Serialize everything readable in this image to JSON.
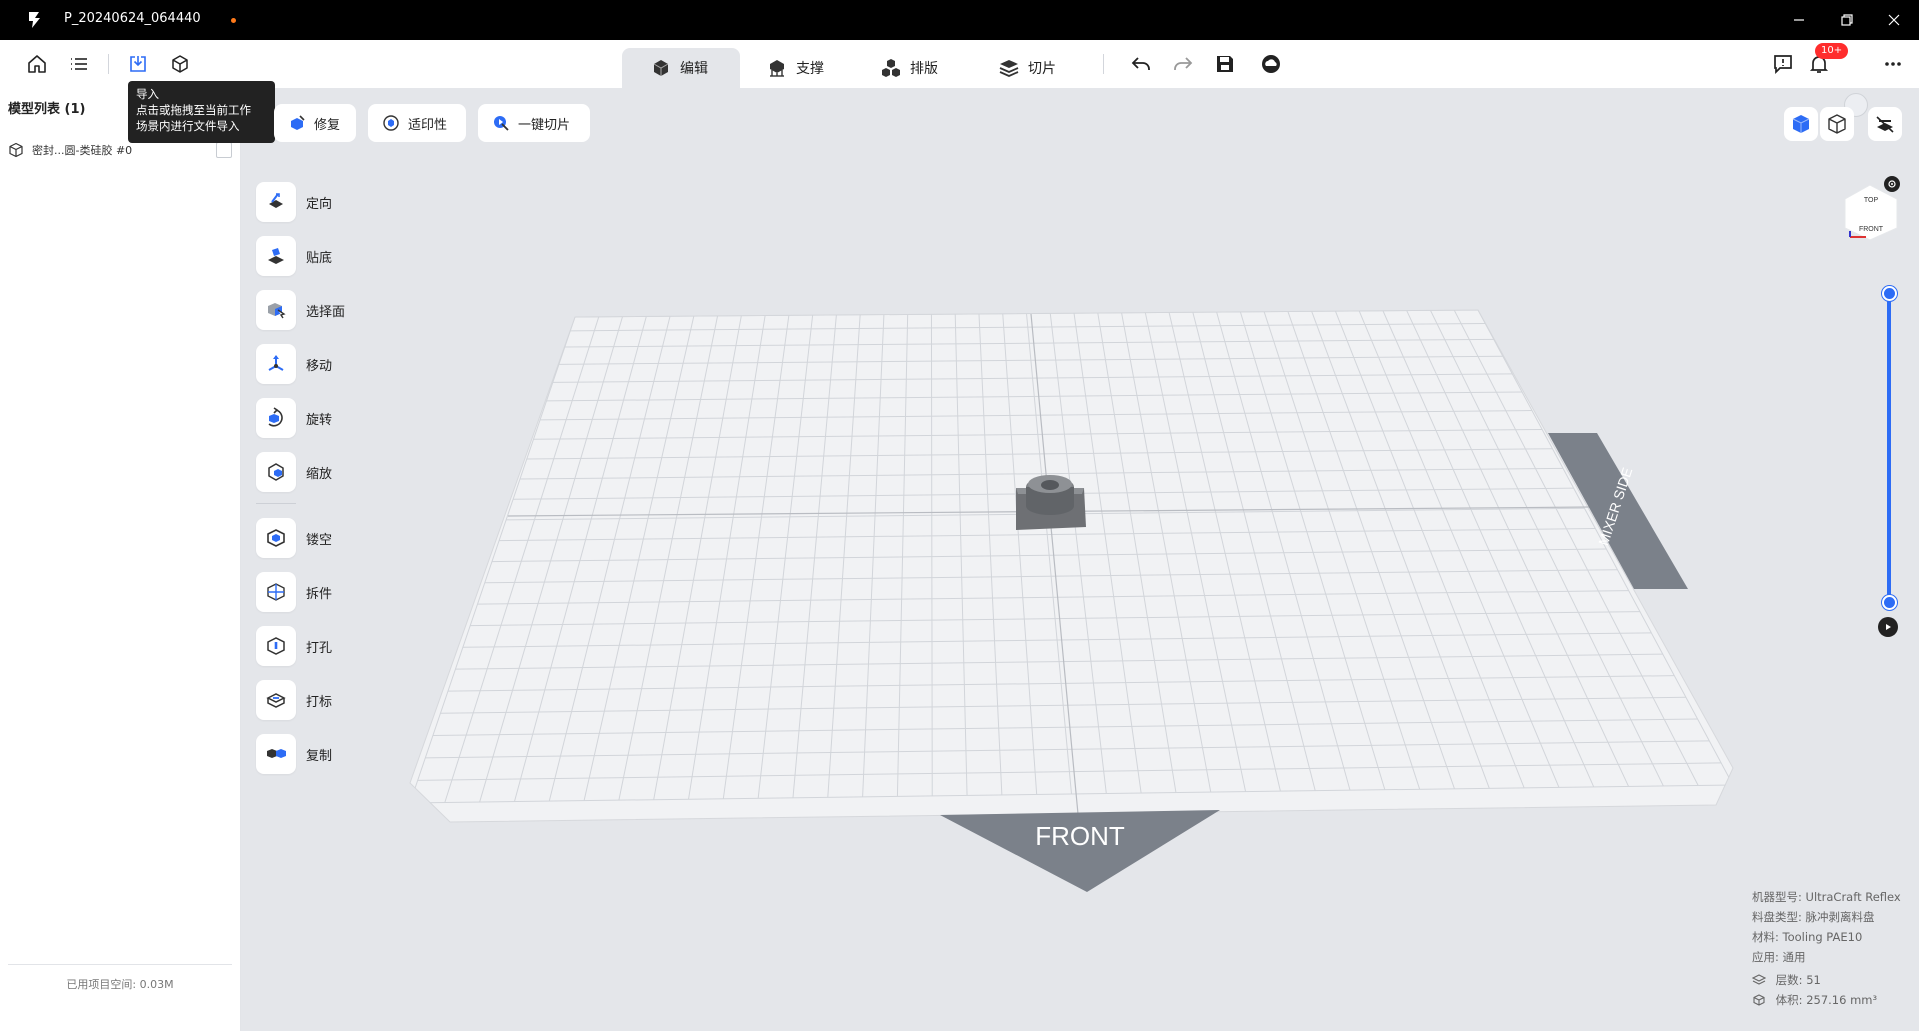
{
  "window": {
    "title": "P_20240624_064440",
    "controls": [
      "minimize-icon",
      "restore-icon",
      "close-icon"
    ]
  },
  "toolbar": {
    "left_icons": [
      "home-icon",
      "list-icon",
      "import-icon",
      "model-cube-icon"
    ],
    "tabs": [
      {
        "label": "编辑",
        "icon": "edit-cube-icon",
        "active": true
      },
      {
        "label": "支撑",
        "icon": "support-icon",
        "active": false
      },
      {
        "label": "排版",
        "icon": "layout-icon",
        "active": false
      },
      {
        "label": "切片",
        "icon": "slice-icon",
        "active": false
      }
    ],
    "actions": [
      "undo-icon",
      "redo-icon",
      "save-icon",
      "cloud-icon"
    ],
    "right": {
      "notification_badge": "10+"
    }
  },
  "tooltip": {
    "title": "导入",
    "line1": "点击或拖拽至当前工作",
    "line2": "场景内进行文件导入"
  },
  "left_panel": {
    "title": "模型列表 (1)",
    "items": [
      {
        "label": "密封...圆-类硅胶 #0"
      }
    ],
    "footer": "已用项目空间: 0.03M"
  },
  "top_buttons": [
    {
      "label": "修复",
      "icon": "repair-icon"
    },
    {
      "label": "适印性",
      "icon": "printability-icon"
    },
    {
      "label": "一键切片",
      "icon": "one-click-slice-icon"
    }
  ],
  "tools": [
    {
      "label": "定向",
      "icon": "orient-icon"
    },
    {
      "label": "贴底",
      "icon": "lay-flat-icon"
    },
    {
      "label": "选择面",
      "icon": "select-face-icon"
    },
    {
      "label": "移动",
      "icon": "move-icon"
    },
    {
      "label": "旋转",
      "icon": "rotate-icon"
    },
    {
      "label": "缩放",
      "icon": "scale-icon"
    },
    {
      "label": "镂空",
      "icon": "hollow-icon"
    },
    {
      "label": "拆件",
      "icon": "split-icon"
    },
    {
      "label": "打孔",
      "icon": "drill-icon"
    },
    {
      "label": "打标",
      "icon": "label-icon"
    },
    {
      "label": "复制",
      "icon": "duplicate-icon"
    }
  ],
  "scene": {
    "platform_front_label": "FRONT",
    "side_label": "MIXER SIDE",
    "view_cube": {
      "top": "TOP",
      "front": "FRONT"
    },
    "accent": "#2d6cf5"
  },
  "info": {
    "machine_label": "机器型号:",
    "machine_value": "UltraCraft Reflex",
    "tray_label": "料盘类型:",
    "tray_value": "脉冲剥离料盘",
    "material_label": "材料:",
    "material_value": "Tooling PAE10",
    "application_label": "应用:",
    "application_value": "通用",
    "layers_label": "层数:",
    "layers_value": "51",
    "volume_label": "体积:",
    "volume_value": "257.16 mm³"
  }
}
